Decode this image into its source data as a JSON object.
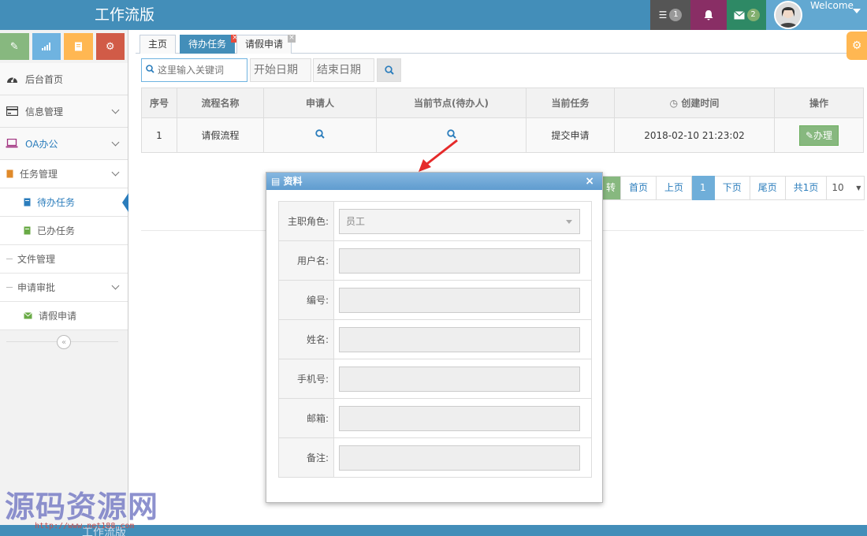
{
  "navbar": {
    "brand": "工作流版",
    "tasks_count": "1",
    "mail_count": "2",
    "welcome": "Welcome"
  },
  "sidebar": {
    "shortcuts": [
      "pencil-icon",
      "signal-icon",
      "book-icon",
      "cogs-icon"
    ],
    "items": [
      {
        "label": "后台首页",
        "icon": "dashboard-icon"
      },
      {
        "label": "信息管理",
        "icon": "credit-card-icon"
      },
      {
        "label": "OA办公",
        "icon": "laptop-icon"
      }
    ],
    "sub": {
      "task_mgmt": "任务管理",
      "todo": "待办任务",
      "done": "已办任务",
      "file_mgmt": "文件管理",
      "apply": "申请审批",
      "leave": "请假申请"
    }
  },
  "tabs": [
    {
      "label": "主页"
    },
    {
      "label": "待办任务"
    },
    {
      "label": "请假申请"
    }
  ],
  "search": {
    "placeholder": "这里输入关键词",
    "start_date": "开始日期",
    "end_date": "结束日期"
  },
  "table": {
    "headers": [
      "序号",
      "流程名称",
      "申请人",
      "当前节点(待办人)",
      "当前任务",
      "创建时间",
      "操作"
    ],
    "rows": [
      {
        "index": "1",
        "name": "请假流程",
        "task": "提交申请",
        "created": "2018-02-10 21:23:02",
        "action": "办理"
      }
    ]
  },
  "pager": {
    "first_cut": "转",
    "first": "首页",
    "prev": "上页",
    "current": "1",
    "next": "下页",
    "last": "尾页",
    "total": "共1页",
    "page_size": "10"
  },
  "modal": {
    "title": "资料",
    "fields": [
      {
        "label": "主职角色:",
        "value": "员工"
      },
      {
        "label": "用户名:",
        "value": ""
      },
      {
        "label": "编号:",
        "value": ""
      },
      {
        "label": "姓名:",
        "value": ""
      },
      {
        "label": "手机号:",
        "value": ""
      },
      {
        "label": "邮箱:",
        "value": ""
      },
      {
        "label": "备注:",
        "value": ""
      }
    ]
  },
  "footer": {
    "brand": "工作流版"
  },
  "watermark": {
    "text": "源码资源网",
    "url": "http://www.net188.com"
  },
  "colors": {
    "primary": "#438eb9",
    "success": "#87b87f",
    "danger": "#d15b47",
    "warning": "#ffb752"
  }
}
